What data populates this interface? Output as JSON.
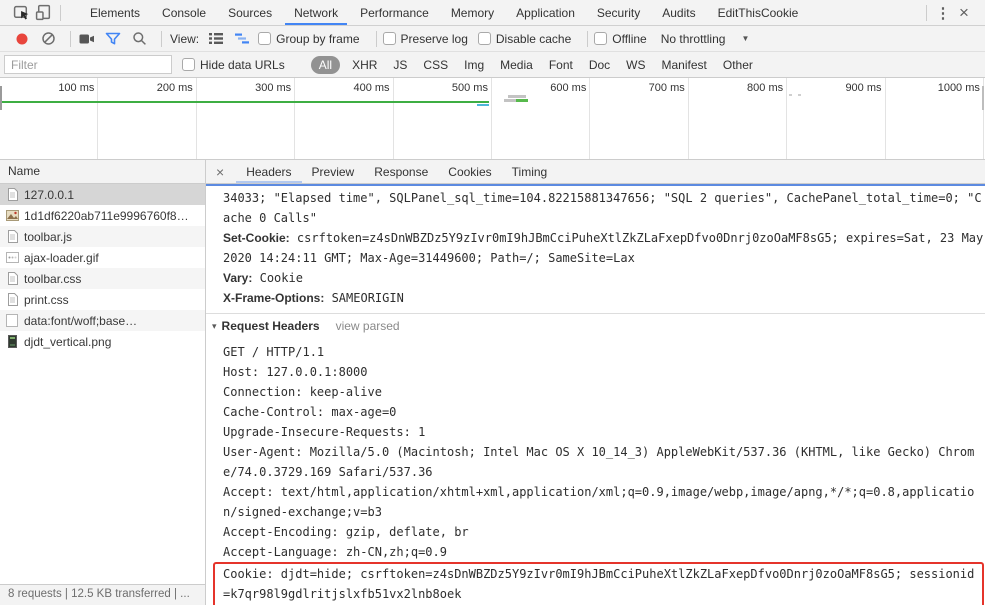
{
  "colors": {
    "accent_blue": "#4285f4",
    "record_red": "#e8453c",
    "timeline_green": "#3dae43",
    "highlight_red": "#e5342b",
    "toolbar_gray": "#f3f3f3",
    "selected_row_gray": "#d6d6d6"
  },
  "main_tabbar": {
    "left_icons": [
      "inspect-icon",
      "device-toolbar-icon"
    ],
    "tabs": [
      "Elements",
      "Console",
      "Sources",
      "Network",
      "Performance",
      "Memory",
      "Application",
      "Security",
      "Audits",
      "EditThisCookie"
    ],
    "selected": "Network",
    "kebab_label": "⋮",
    "close_label": "×"
  },
  "network_toolbar": {
    "icons": [
      "record-icon",
      "clear-icon",
      "screenshot-icon",
      "filter-funnel-icon",
      "search-icon",
      "list-view-icon",
      "waterfall-view-icon"
    ],
    "view_label": "View:",
    "checkboxes": [
      {
        "label": "Group by frame",
        "checked": false
      },
      {
        "label": "Preserve log",
        "checked": false
      },
      {
        "label": "Disable cache",
        "checked": false
      },
      {
        "label": "Offline",
        "checked": false
      }
    ],
    "throttling_value": "No throttling",
    "throttling_caret": "▼"
  },
  "filter_bar": {
    "input_placeholder": "Filter",
    "input_value": "",
    "hide_data_urls_label": "Hide data URLs",
    "type_filters": [
      "All",
      "XHR",
      "JS",
      "CSS",
      "Img",
      "Media",
      "Font",
      "Doc",
      "WS",
      "Manifest",
      "Other"
    ],
    "selected_type": "All"
  },
  "timeline_overview": {
    "ticks": [
      "100 ms",
      "200 ms",
      "300 ms",
      "400 ms",
      "500 ms",
      "600 ms",
      "700 ms",
      "800 ms",
      "900 ms",
      "1000 ms"
    ]
  },
  "request_list": {
    "header": "Name",
    "rows": [
      {
        "label": "127.0.0.1",
        "icon": "document-icon",
        "selected": true
      },
      {
        "label": "1d1df6220ab711e9996760f8…",
        "icon": "image-icon",
        "selected": false
      },
      {
        "label": "toolbar.js",
        "icon": "document-icon",
        "selected": false
      },
      {
        "label": "ajax-loader.gif",
        "icon": "loader-image-icon",
        "selected": false
      },
      {
        "label": "toolbar.css",
        "icon": "document-icon",
        "selected": false
      },
      {
        "label": "print.css",
        "icon": "document-icon",
        "selected": false
      },
      {
        "label": "data:font/woff;base…",
        "icon": "plain-file-icon",
        "selected": false
      },
      {
        "label": "djdt_vertical.png",
        "icon": "dark-image-icon",
        "selected": false
      }
    ]
  },
  "detail_pane": {
    "close_label": "×",
    "tabs": [
      "Headers",
      "Preview",
      "Response",
      "Cookies",
      "Timing"
    ],
    "selected_tab": "Headers",
    "response_headers": [
      {
        "name": "",
        "value": "34033; \"Elapsed time\", SQLPanel_sql_time=104.82215881347656; \"SQL 2 queries\", CachePanel_total_time=0; \"Cache 0 Calls\""
      },
      {
        "name": "Set-Cookie:",
        "value": "csrftoken=z4sDnWBZDz5Y9zIvr0mI9hJBmCciPuheXtlZkZLaFxepDfvo0Dnrj0zoOaMF8sG5; expires=Sat, 23 May 2020 14:24:11 GMT; Max-Age=31449600; Path=/; SameSite=Lax"
      },
      {
        "name": "Vary:",
        "value": "Cookie"
      },
      {
        "name": "X-Frame-Options:",
        "value": "SAMEORIGIN"
      }
    ],
    "request_headers_section": {
      "expander": "▾",
      "title": "Request Headers",
      "action_link": "view parsed",
      "raw_lines": [
        {
          "text": "GET / HTTP/1.1",
          "highlight": false
        },
        {
          "text": "Host: 127.0.0.1:8000",
          "highlight": false
        },
        {
          "text": "Connection: keep-alive",
          "highlight": false
        },
        {
          "text": "Cache-Control: max-age=0",
          "highlight": false
        },
        {
          "text": "Upgrade-Insecure-Requests: 1",
          "highlight": false
        },
        {
          "text": "User-Agent: Mozilla/5.0 (Macintosh; Intel Mac OS X 10_14_3) AppleWebKit/537.36 (KHTML, like Gecko) Chrome/74.0.3729.169 Safari/537.36",
          "highlight": false
        },
        {
          "text": "Accept: text/html,application/xhtml+xml,application/xml;q=0.9,image/webp,image/apng,*/*;q=0.8,application/signed-exchange;v=b3",
          "highlight": false
        },
        {
          "text": "Accept-Encoding: gzip, deflate, br",
          "highlight": false
        },
        {
          "text": "Accept-Language: zh-CN,zh;q=0.9",
          "highlight": false
        },
        {
          "text": "Cookie: djdt=hide; csrftoken=z4sDnWBZDz5Y9zIvr0mI9hJBmCciPuheXtlZkZLaFxepDfvo0Dnrj0zoOaMF8sG5; sessionid=k7qr98l9gdlritjslxfb51vx2lnb8oek",
          "highlight": true
        }
      ]
    }
  },
  "status_bar": {
    "text": "8 requests | 12.5 KB transferred | ..."
  }
}
